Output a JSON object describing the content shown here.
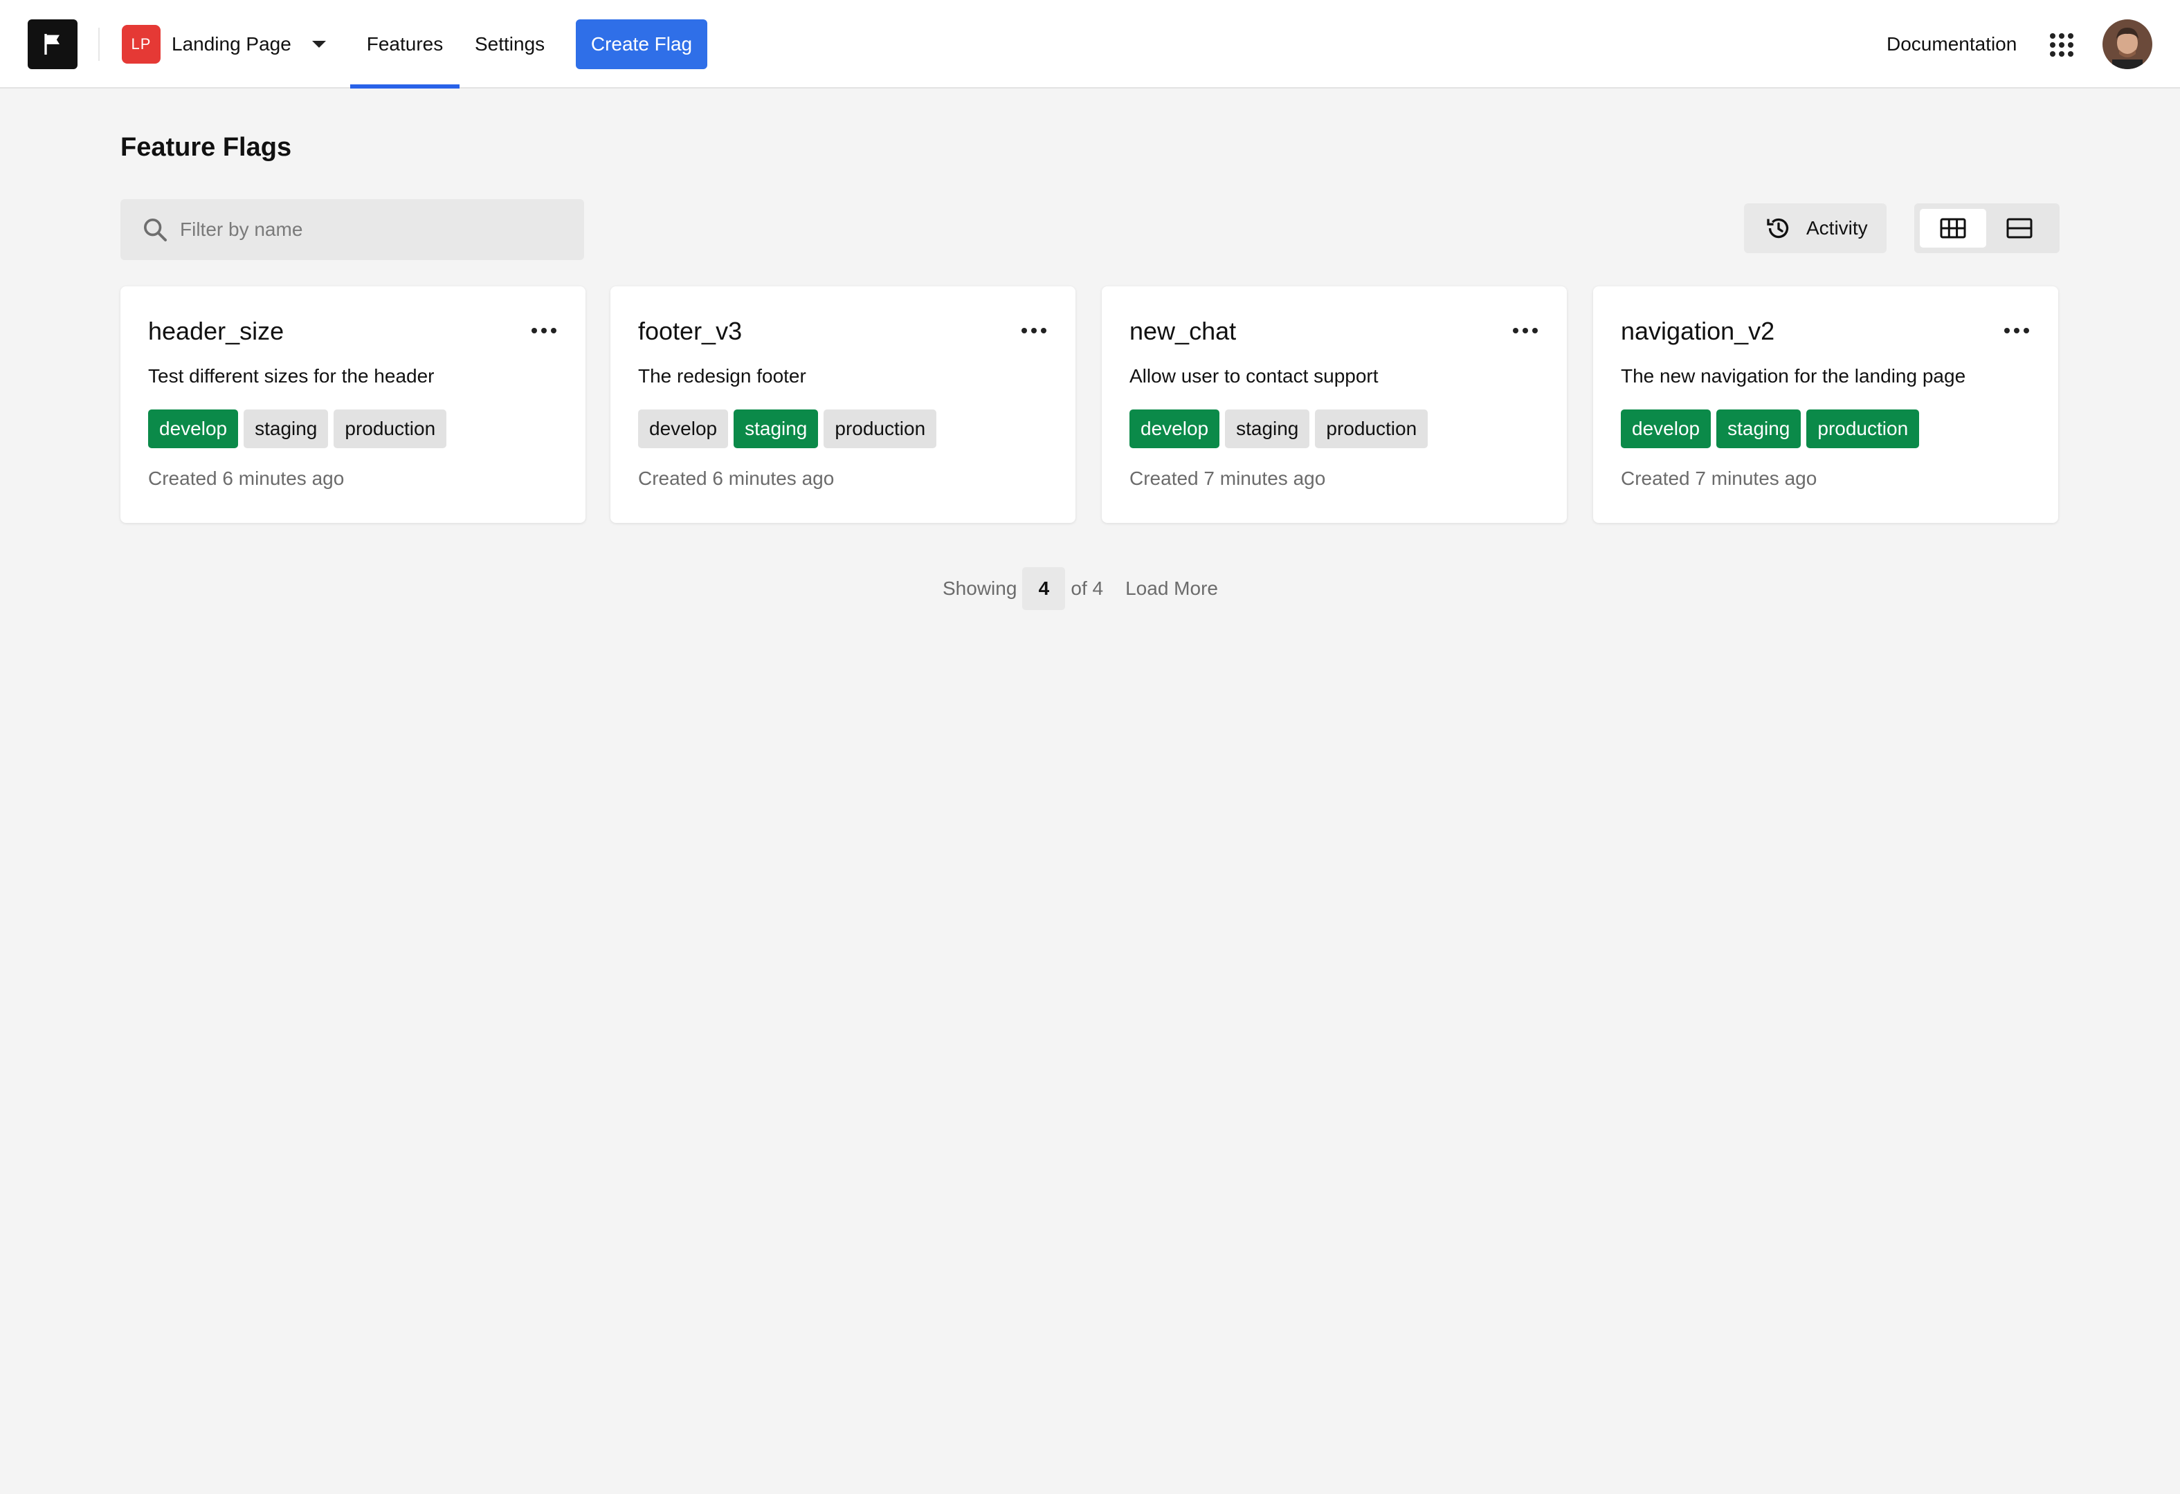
{
  "header": {
    "logo_icon": "flag-icon",
    "project": {
      "initials": "LP",
      "name": "Landing Page",
      "badge_color": "#e53935"
    },
    "nav": {
      "features_label": "Features",
      "settings_label": "Settings"
    },
    "create_label": "Create Flag",
    "docs_label": "Documentation",
    "apps_icon": "grid-dots-icon",
    "accent_color": "#2f6fe8"
  },
  "main": {
    "title": "Feature Flags",
    "search": {
      "placeholder": "Filter by name",
      "value": ""
    },
    "activity_label": "Activity",
    "view_toggle": {
      "selected": "grid"
    }
  },
  "flags": [
    {
      "name": "header_size",
      "description": "Test different sizes for the header",
      "environments": [
        {
          "label": "develop",
          "enabled": true
        },
        {
          "label": "staging",
          "enabled": false
        },
        {
          "label": "production",
          "enabled": false
        }
      ],
      "created": "Created 6 minutes ago"
    },
    {
      "name": "footer_v3",
      "description": "The redesign footer",
      "environments": [
        {
          "label": "develop",
          "enabled": false
        },
        {
          "label": "staging",
          "enabled": true
        },
        {
          "label": "production",
          "enabled": false
        }
      ],
      "created": "Created 6 minutes ago"
    },
    {
      "name": "new_chat",
      "description": "Allow user to contact support",
      "environments": [
        {
          "label": "develop",
          "enabled": true
        },
        {
          "label": "staging",
          "enabled": false
        },
        {
          "label": "production",
          "enabled": false
        }
      ],
      "created": "Created 7 minutes ago"
    },
    {
      "name": "navigation_v2",
      "description": "The new navigation for the landing page",
      "environments": [
        {
          "label": "develop",
          "enabled": true
        },
        {
          "label": "staging",
          "enabled": true
        },
        {
          "label": "production",
          "enabled": true
        }
      ],
      "created": "Created 7 minutes ago"
    }
  ],
  "pager": {
    "showing_label": "Showing",
    "count": "4",
    "of_label": "of 4",
    "load_more_label": "Load More"
  },
  "colors": {
    "enabled_tag": "#0b8a49",
    "disabled_tag": "#e2e2e2"
  }
}
